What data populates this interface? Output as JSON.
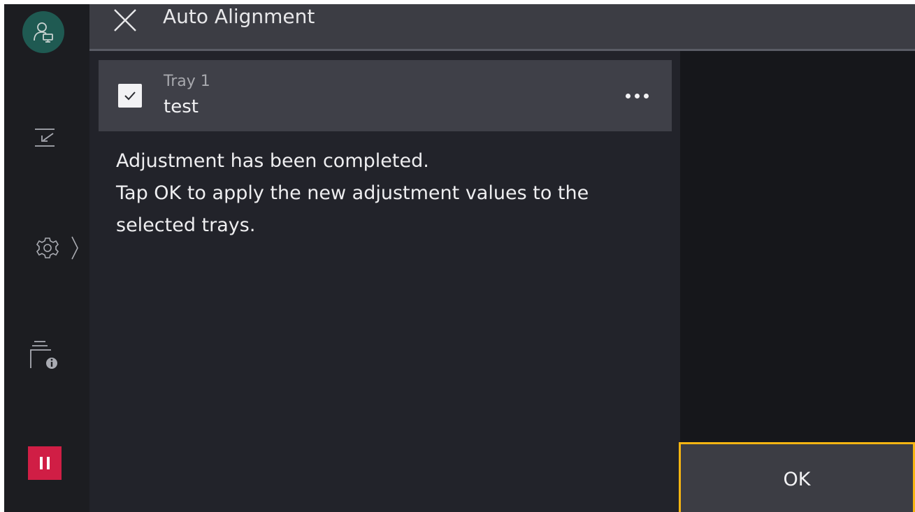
{
  "header": {
    "title": "Auto Alignment"
  },
  "tray": {
    "name": "Tray 1",
    "description": "test",
    "checked": true
  },
  "message": {
    "lines": [
      "Adjustment has been completed.",
      "Tap OK to apply the new adjustment values to the",
      "selected trays."
    ]
  },
  "actions": {
    "ok_label": "OK"
  },
  "sidebar": {
    "icons": [
      "user-account-icon",
      "job-flow-icon",
      "settings-icon",
      "device-info-icon",
      "pause-icon"
    ]
  },
  "colors": {
    "accent": "#f7b512",
    "stop": "#d01e45",
    "avatar": "#1f5a52"
  }
}
